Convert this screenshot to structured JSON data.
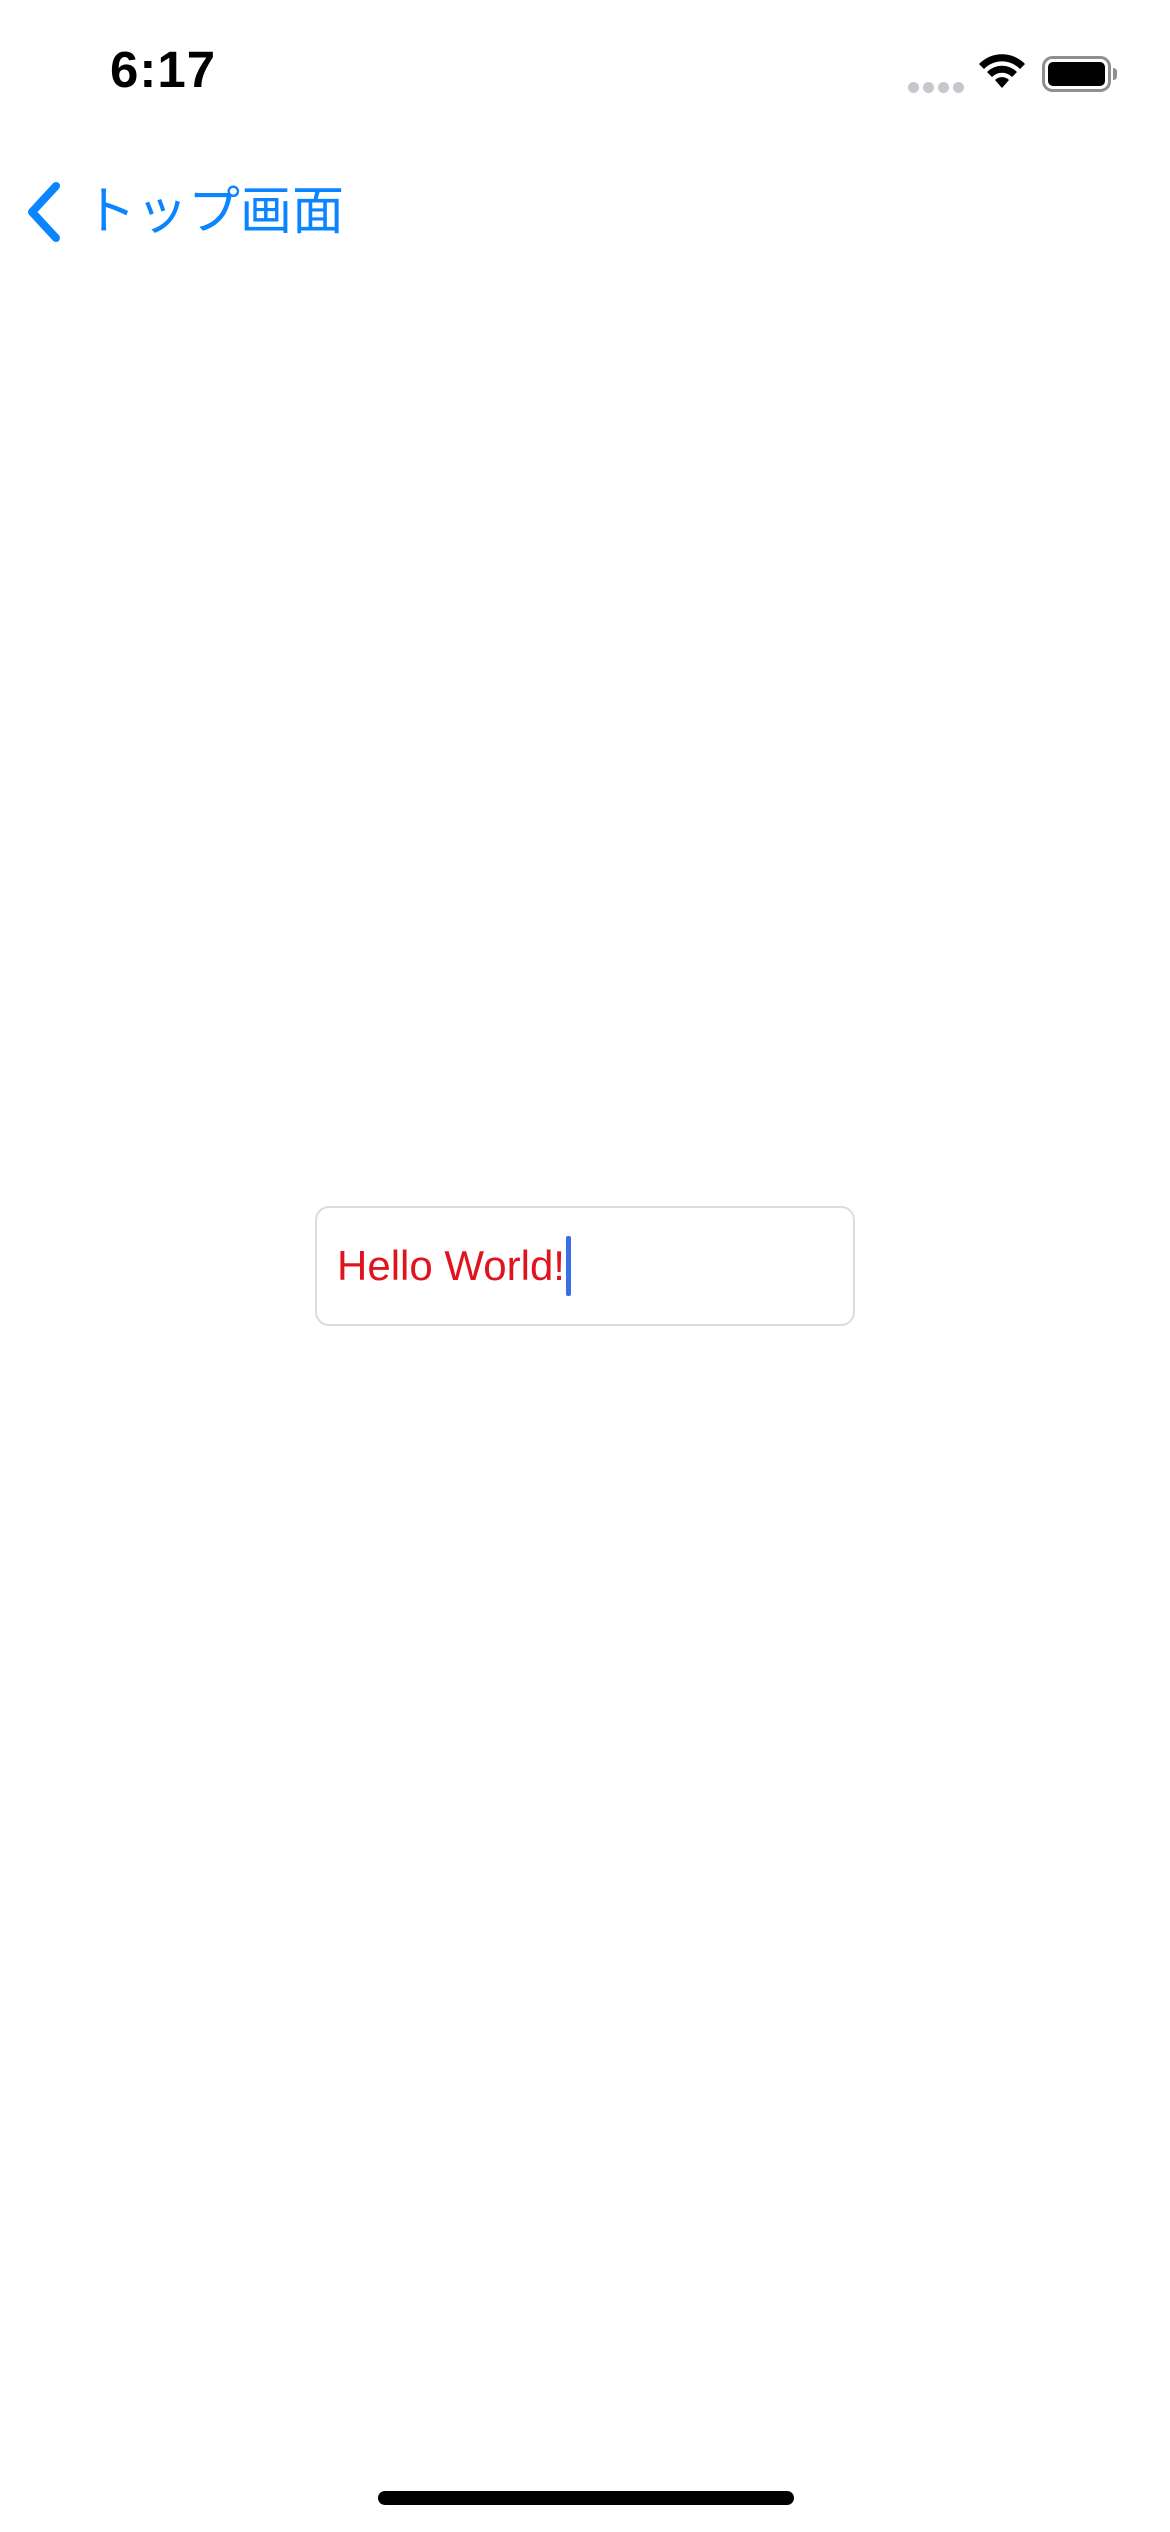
{
  "status_bar": {
    "time": "6:17"
  },
  "nav": {
    "back_label": "トップ画面"
  },
  "text_field": {
    "value": "Hello World!"
  },
  "colors": {
    "accent": "#0a84ff",
    "text_value": "#e0141e",
    "caret": "#3a6fe8",
    "field_border": "#dcdcdf"
  },
  "icons": {
    "back": "chevron-left-icon",
    "wifi": "wifi-icon",
    "battery": "battery-icon",
    "signal": "cellular-signal-icon"
  }
}
